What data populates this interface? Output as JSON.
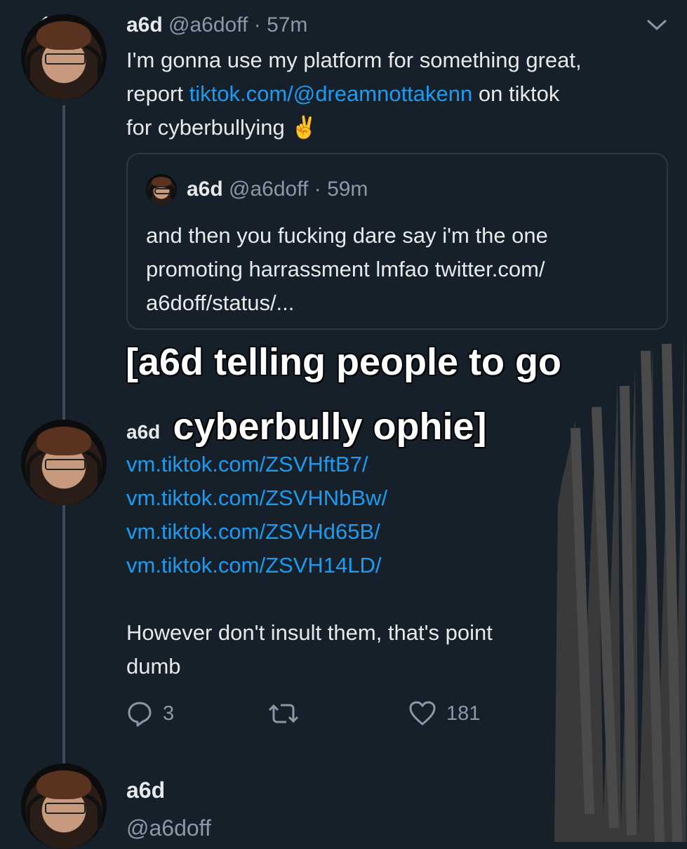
{
  "nav": {
    "back_icon": "back-arrow-icon",
    "chevron_icon": "chevron-down-icon"
  },
  "tweet1": {
    "name": "a6d",
    "handle": "@a6doff",
    "sep": "·",
    "time": "57m",
    "text_line1": "I'm gonna use my platform for something great,",
    "text_line2_prefix": "report ",
    "text_link": "tiktok.com/@dreamnottakenn",
    "text_line2_suffix": " on tiktok",
    "text_line3": "for cyberbullying ✌️"
  },
  "quote": {
    "name": "a6d",
    "handle": "@a6doff",
    "sep": "·",
    "time": "59m",
    "line1": "and then you fucking dare say i'm the one",
    "line2": "promoting harrassment lmfao twitter.com/",
    "line3": "a6doff/status/..."
  },
  "caption": {
    "line1": "[a6d telling people to go",
    "line2": "cyberbully ophie]"
  },
  "tweet2": {
    "name": "a6d",
    "links": [
      "vm.tiktok.com/ZSVHftB7/",
      "vm.tiktok.com/ZSVHNbBw/",
      "vm.tiktok.com/ZSVHd65B/",
      "vm.tiktok.com/ZSVH14LD/"
    ],
    "text_line1": "However don't insult them, that's point",
    "text_line2": "dumb",
    "reply_count": "3",
    "like_count": "181"
  },
  "tweet3": {
    "name": "a6d",
    "handle": "@a6doff"
  },
  "colors": {
    "background": "#16202b",
    "link": "#1d9bf0",
    "muted": "#8b98a5"
  }
}
